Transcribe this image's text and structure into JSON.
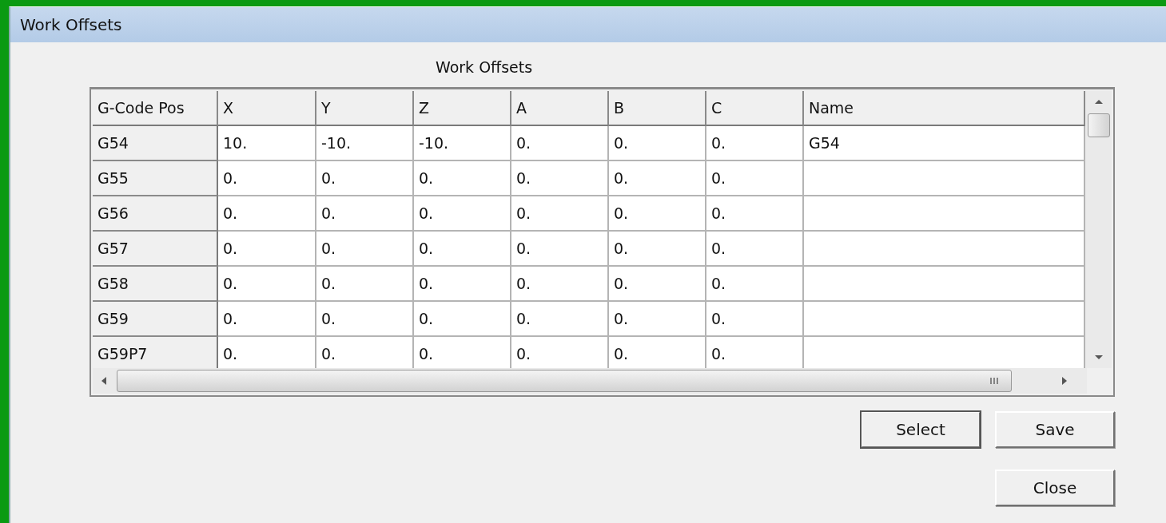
{
  "window": {
    "title": "Work Offsets"
  },
  "grid": {
    "caption": "Work Offsets",
    "columns": [
      "G-Code Pos",
      "X",
      "Y",
      "Z",
      "A",
      "B",
      "C",
      "Name"
    ],
    "rows": [
      [
        "G54",
        "10.",
        "-10.",
        "-10.",
        "0.",
        "0.",
        "0.",
        "G54"
      ],
      [
        "G55",
        "0.",
        "0.",
        "0.",
        "0.",
        "0.",
        "0.",
        ""
      ],
      [
        "G56",
        "0.",
        "0.",
        "0.",
        "0.",
        "0.",
        "0.",
        ""
      ],
      [
        "G57",
        "0.",
        "0.",
        "0.",
        "0.",
        "0.",
        "0.",
        ""
      ],
      [
        "G58",
        "0.",
        "0.",
        "0.",
        "0.",
        "0.",
        "0.",
        ""
      ],
      [
        "G59",
        "0.",
        "0.",
        "0.",
        "0.",
        "0.",
        "0.",
        ""
      ],
      [
        "G59P7",
        "0.",
        "0.",
        "0.",
        "0.",
        "0.",
        "0.",
        ""
      ]
    ]
  },
  "buttons": [
    {
      "label": "Select",
      "default": true
    },
    {
      "label": "Save",
      "default": false
    },
    {
      "label": "Close",
      "default": false
    }
  ]
}
